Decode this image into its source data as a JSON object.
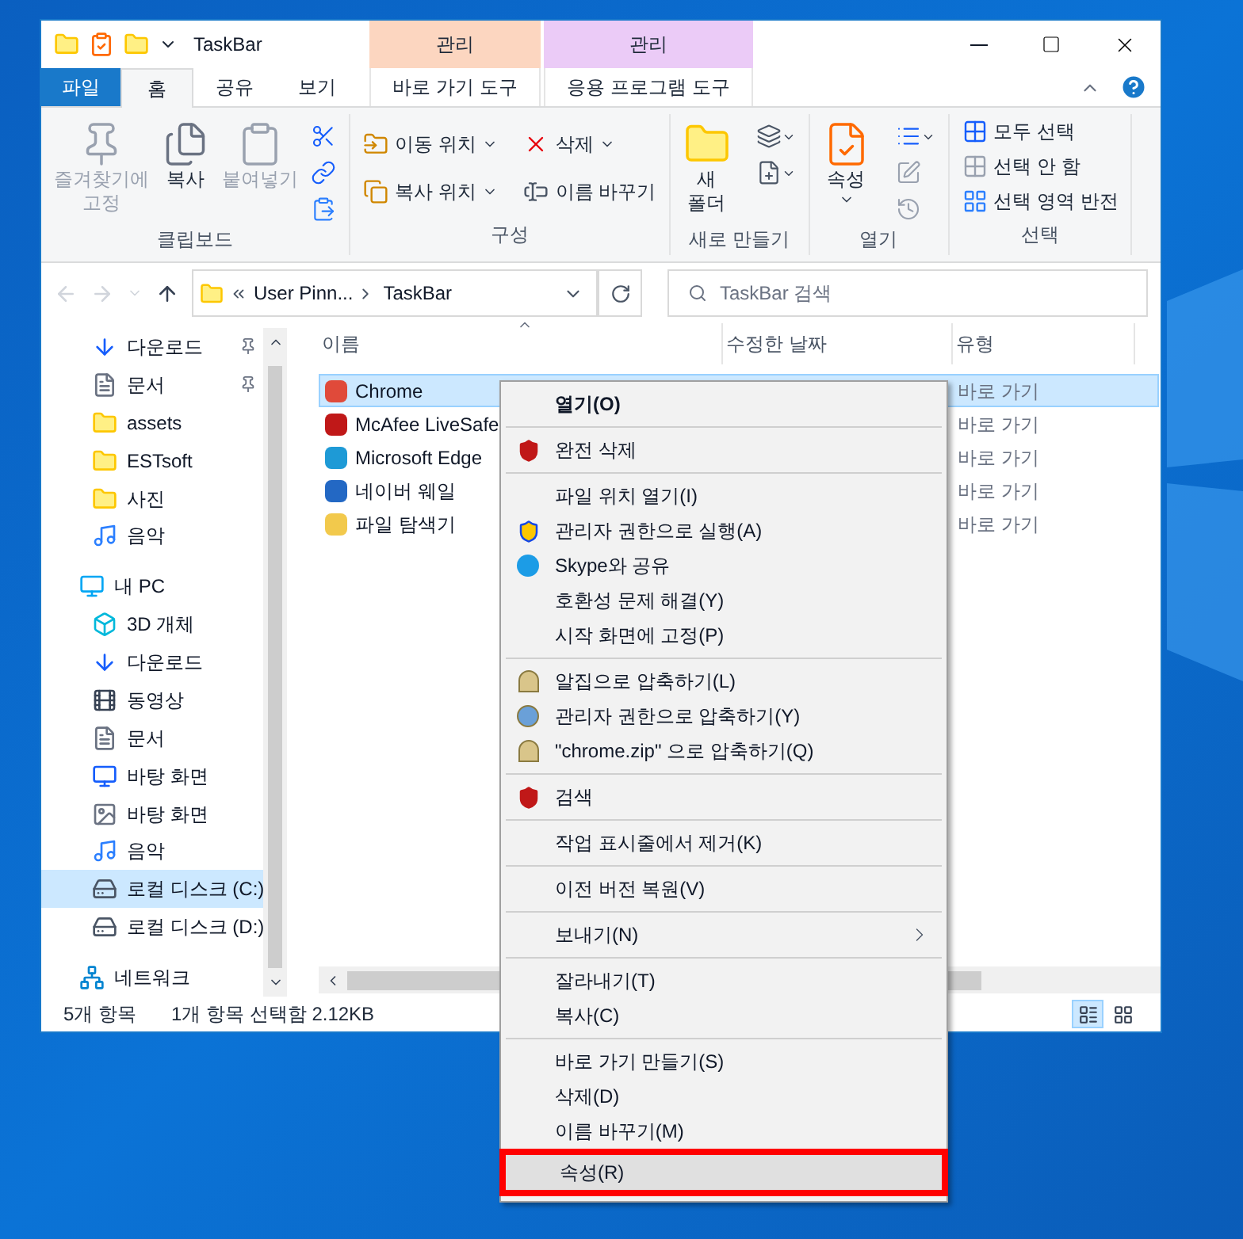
{
  "window": {
    "title": "TaskBar"
  },
  "context_tab_groups": [
    {
      "header": "관리",
      "tab": "바로 가기 도구",
      "color": "#fcd6c0"
    },
    {
      "header": "관리",
      "tab": "응용 프로그램 도구",
      "color": "#ebcbf7"
    }
  ],
  "tabs": [
    {
      "label": "파일",
      "kind": "file",
      "selected": false
    },
    {
      "label": "홈",
      "kind": "normal",
      "selected": true
    },
    {
      "label": "공유",
      "kind": "normal",
      "selected": false
    },
    {
      "label": "보기",
      "kind": "normal",
      "selected": false
    }
  ],
  "ribbon": [
    {
      "label": "클립보드",
      "kind": "clipboard",
      "items": [
        {
          "kind": "large",
          "lines": [
            "즐겨찾기에",
            "고정"
          ],
          "dropdown": false,
          "disabled": true
        },
        {
          "kind": "large",
          "lines": [
            "복사"
          ],
          "dropdown": false,
          "disabled": false
        },
        {
          "kind": "large",
          "lines": [
            "붙여넣기"
          ],
          "dropdown": false,
          "disabled": true
        }
      ]
    },
    {
      "label": "구성",
      "kind": "organize",
      "items": [
        {
          "kind": "small",
          "label": "이동 위치",
          "dropdown": true,
          "disabled": false
        },
        {
          "kind": "small",
          "label": "복사 위치",
          "dropdown": true,
          "disabled": false
        },
        {
          "kind": "small",
          "label": "삭제",
          "dropdown": true,
          "disabled": false
        },
        {
          "kind": "small",
          "label": "이름 바꾸기",
          "dropdown": false,
          "disabled": false
        }
      ]
    },
    {
      "label": "새로 만들기",
      "kind": "new",
      "items": [
        {
          "kind": "large",
          "lines": [
            "새",
            "폴더"
          ],
          "dropdown": false,
          "disabled": false
        }
      ]
    },
    {
      "label": "열기",
      "kind": "open",
      "items": [
        {
          "kind": "large",
          "lines": [
            "속성"
          ],
          "dropdown": true,
          "disabled": false
        }
      ]
    },
    {
      "label": "선택",
      "kind": "select",
      "items": [
        {
          "kind": "small",
          "label": "모두 선택",
          "dropdown": false,
          "disabled": false
        },
        {
          "kind": "small",
          "label": "선택 안 함",
          "dropdown": false,
          "disabled": false
        },
        {
          "kind": "small",
          "label": "선택 영역 반전",
          "dropdown": false,
          "disabled": false
        }
      ]
    }
  ],
  "address": {
    "path": [
      "User Pinn...",
      "TaskBar"
    ]
  },
  "search": {
    "placeholder": "TaskBar 검색"
  },
  "quick_access": [
    {
      "label": "다운로드",
      "kind": "download",
      "pinned": true,
      "selected": false
    },
    {
      "label": "문서",
      "kind": "document",
      "pinned": true,
      "selected": false
    },
    {
      "label": "assets",
      "kind": "folder",
      "pinned": false,
      "selected": false
    },
    {
      "label": "ESTsoft",
      "kind": "folder",
      "pinned": false,
      "selected": false
    },
    {
      "label": "사진",
      "kind": "folder",
      "pinned": false,
      "selected": false
    },
    {
      "label": "음악",
      "kind": "music",
      "pinned": false,
      "selected": false
    }
  ],
  "tree": [
    {
      "label": "내 PC",
      "kind": "pc",
      "selected": false,
      "children": [
        {
          "label": "3D 개체",
          "kind": "cube",
          "selected": false
        },
        {
          "label": "다운로드",
          "kind": "download",
          "selected": false
        },
        {
          "label": "동영상",
          "kind": "video",
          "selected": false
        },
        {
          "label": "문서",
          "kind": "document",
          "selected": false
        },
        {
          "label": "바탕 화면",
          "kind": "desktop",
          "selected": false
        },
        {
          "label": "바탕 화면",
          "kind": "picture",
          "selected": false
        },
        {
          "label": "음악",
          "kind": "music",
          "selected": false
        },
        {
          "label": "로컬 디스크 (C:)",
          "kind": "drive",
          "selected": true
        },
        {
          "label": "로컬 디스크 (D:)",
          "kind": "drive",
          "selected": false
        }
      ]
    },
    {
      "label": "네트워크",
      "kind": "network",
      "selected": false
    }
  ],
  "columns": [
    "이름",
    "수정한 날짜",
    "유형"
  ],
  "files": [
    {
      "name": "Chrome",
      "kind": "chrome",
      "type": "바로 가기",
      "selected": true
    },
    {
      "name": "McAfee LiveSafe",
      "kind": "mcafee",
      "type": "바로 가기",
      "selected": false
    },
    {
      "name": "Microsoft Edge",
      "kind": "edge",
      "type": "바로 가기",
      "selected": false
    },
    {
      "name": "네이버 웨일",
      "kind": "whale",
      "type": "바로 가기",
      "selected": false
    },
    {
      "name": "파일 탐색기",
      "kind": "explorer",
      "type": "바로 가기",
      "selected": false
    }
  ],
  "status_bar": {
    "count": "5개 항목",
    "selection": "1개 항목 선택함 2.12KB",
    "views": [
      {
        "kind": "details",
        "selected": true
      },
      {
        "kind": "tiles",
        "selected": false
      }
    ]
  },
  "context_menu": [
    [
      {
        "label": "열기(O)",
        "kind": "default",
        "selected": false
      }
    ],
    [
      {
        "label": "완전 삭제",
        "kind": "mcafee",
        "selected": false
      }
    ],
    [
      {
        "label": "파일 위치 열기(I)",
        "kind": "plain",
        "selected": false
      },
      {
        "label": "관리자 권한으로 실행(A)",
        "kind": "admin",
        "selected": false
      },
      {
        "label": "Skype와 공유",
        "kind": "skype",
        "selected": false
      },
      {
        "label": "호환성 문제 해결(Y)",
        "kind": "plain",
        "selected": false
      },
      {
        "label": "시작 화면에 고정(P)",
        "kind": "plain",
        "selected": false
      }
    ],
    [
      {
        "label": "알집으로 압축하기(L)",
        "kind": "archive",
        "selected": false
      },
      {
        "label": "관리자 권한으로 압축하기(Y)",
        "kind": "archiveadmin",
        "selected": false
      },
      {
        "label": "\"chrome.zip\" 으로 압축하기(Q)",
        "kind": "archive",
        "selected": false
      }
    ],
    [
      {
        "label": "검색",
        "kind": "mcafee",
        "selected": false
      }
    ],
    [
      {
        "label": "작업 표시줄에서 제거(K)",
        "kind": "plain",
        "selected": false
      }
    ],
    [
      {
        "label": "이전 버전 복원(V)",
        "kind": "plain",
        "selected": false
      }
    ],
    [
      {
        "label": "보내기(N)",
        "kind": "submenu",
        "selected": false
      }
    ],
    [
      {
        "label": "잘라내기(T)",
        "kind": "plain",
        "selected": false
      },
      {
        "label": "복사(C)",
        "kind": "plain",
        "selected": false
      }
    ],
    [
      {
        "label": "바로 가기 만들기(S)",
        "kind": "plain",
        "selected": false
      },
      {
        "label": "삭제(D)",
        "kind": "plain",
        "selected": false
      },
      {
        "label": "이름 바꾸기(M)",
        "kind": "plain",
        "selected": false
      },
      {
        "label": "속성(R)",
        "kind": "plain",
        "selected": true
      }
    ]
  ]
}
